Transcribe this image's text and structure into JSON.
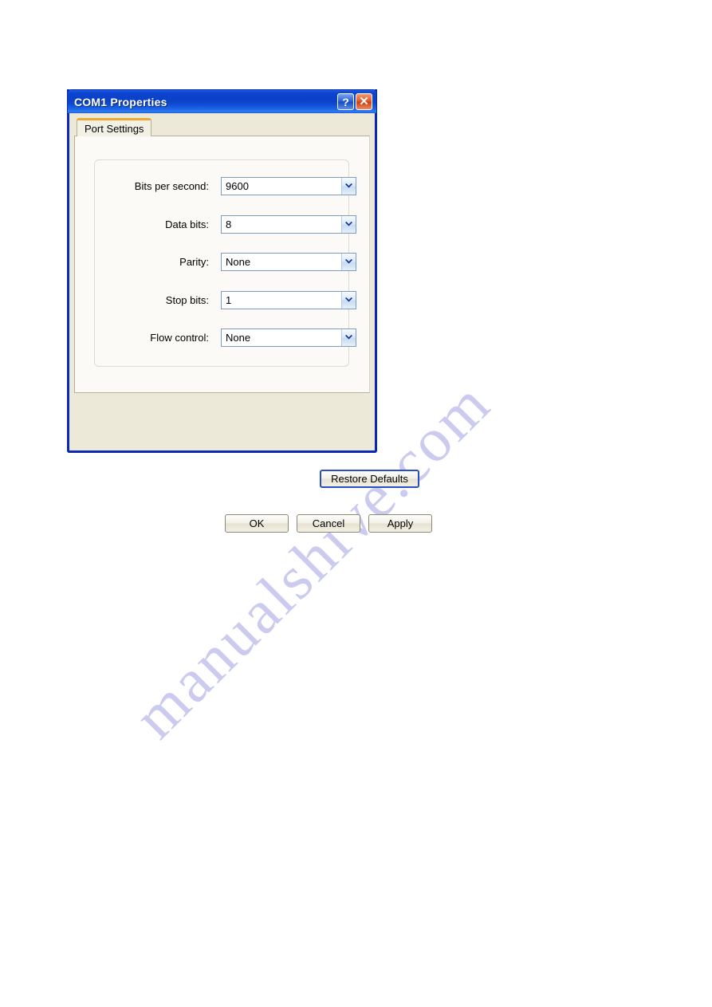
{
  "watermark": {
    "text": "manualshive.com"
  },
  "dialog": {
    "title": "COM1 Properties",
    "title_buttons": [
      {
        "name": "help-button",
        "glyph": "?"
      },
      {
        "name": "close-button",
        "glyph": "✕"
      }
    ],
    "tabs": [
      {
        "label": "Port Settings",
        "active": true
      }
    ],
    "fields": [
      {
        "label": "Bits per second:",
        "value": "9600"
      },
      {
        "label": "Data bits:",
        "value": "8"
      },
      {
        "label": "Parity:",
        "value": "None"
      },
      {
        "label": "Stop bits:",
        "value": "1"
      },
      {
        "label": "Flow control:",
        "value": "None"
      }
    ],
    "restore_defaults_label": "Restore Defaults",
    "buttons": [
      {
        "label": "OK"
      },
      {
        "label": "Cancel"
      },
      {
        "label": "Apply"
      }
    ]
  },
  "colors": {
    "titlebar_blue": "#0c43cd",
    "dialog_border": "#0a28b8",
    "dialog_face": "#ece9d8",
    "tab_accent_orange": "#f0a732",
    "combo_border": "#7f9db9",
    "focus_border": "#2a4fc4",
    "watermark": "#c9c9ef"
  }
}
